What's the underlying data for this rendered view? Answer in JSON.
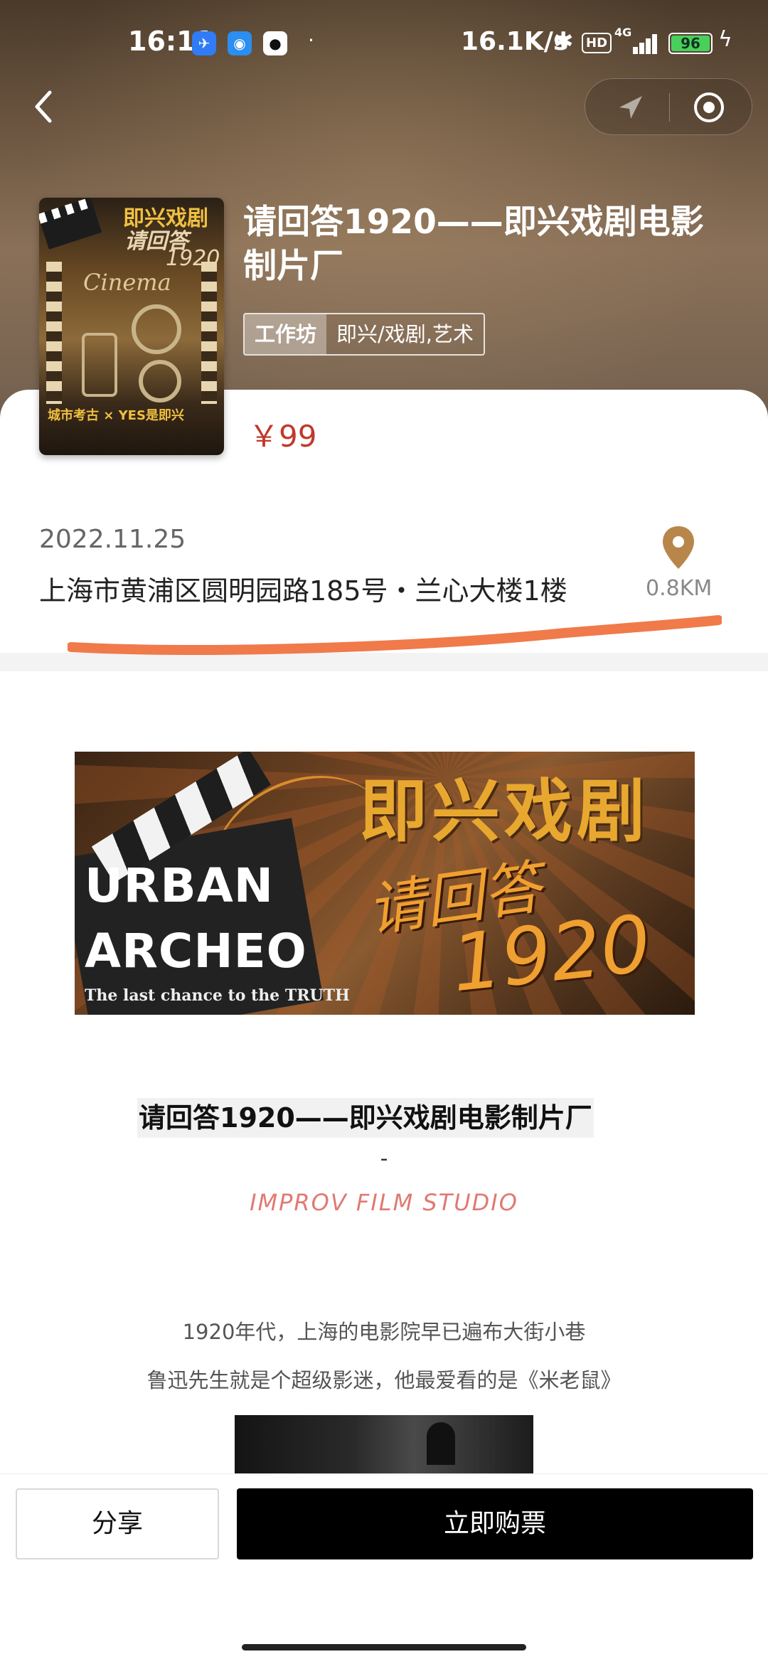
{
  "status_bar": {
    "time": "16:11",
    "network_speed": "16.1K/s",
    "hd": "HD",
    "network_type": "4G",
    "battery": "96"
  },
  "event": {
    "title": "请回答1920——即兴戏剧电影制片厂",
    "tag_primary": "工作坊",
    "tag_secondary": "即兴/戏剧,艺术",
    "price": "￥99",
    "date": "2022.11.25",
    "address": "上海市黄浦区圆明园路185号・兰心大楼1楼",
    "distance": "0.8KM"
  },
  "poster": {
    "title": "即兴戏剧",
    "subtitle": "请回答",
    "year": "1920",
    "script_word": "Cinema",
    "footer": "城市考古 × YES是即兴"
  },
  "banner": {
    "line1": "URBAN",
    "line2": "ARCHEO",
    "tagline": "The last chance to the TRUTH",
    "zh_title": "即兴戏剧",
    "zh_subtitle": "请回答",
    "zh_year": "1920"
  },
  "content": {
    "heading": "请回答1920——即兴戏剧电影制片厂",
    "separator": "-",
    "subheading": "IMPROV FILM STUDIO",
    "paragraph1": "1920年代，上海的电影院早已遍布大街小巷",
    "paragraph2": "鲁迅先生就是个超级影迷，他最爱看的是《米老鼠》"
  },
  "actions": {
    "share_label": "分享",
    "buy_label": "立即购票"
  },
  "colors": {
    "price": "#c0392b",
    "buy_button": "#000000",
    "subheading": "#e07a72",
    "annotation_underline": "#f07a4a",
    "pin": "#b8864a"
  },
  "icons": [
    "back-chevron-icon",
    "location-arrow-icon",
    "record-target-icon",
    "map-pin-icon"
  ]
}
